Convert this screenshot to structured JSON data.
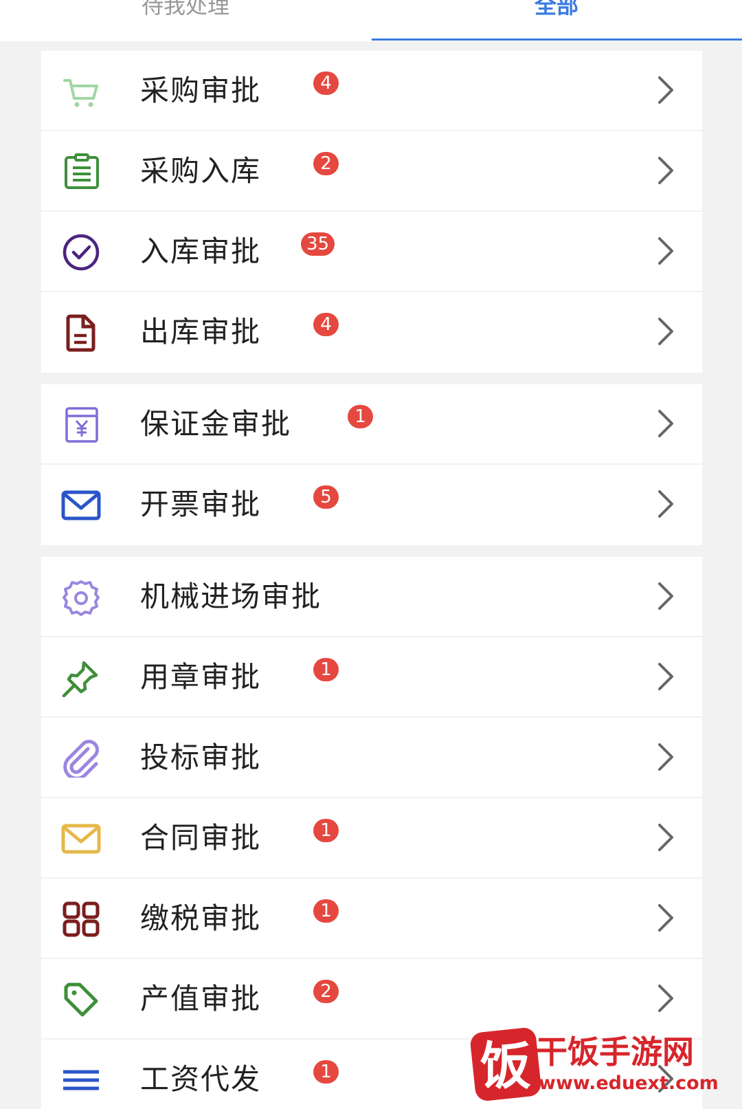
{
  "tabs": [
    {
      "label": "待我处理",
      "active": false
    },
    {
      "label": "全部",
      "active": true
    }
  ],
  "colors": {
    "accent": "#3a7be0",
    "badge": "#e5483f",
    "background": "#f2f2f2"
  },
  "groups": [
    {
      "items": [
        {
          "label": "采购审批",
          "badge": "4",
          "icon": "cart-icon",
          "color": "#9fd6a2"
        },
        {
          "label": "采购入库",
          "badge": "2",
          "icon": "clipboard-icon",
          "color": "#3f8f3a"
        },
        {
          "label": "入库审批",
          "badge": "35",
          "icon": "check-circle-icon",
          "color": "#4a2580"
        },
        {
          "label": "出库审批",
          "badge": "4",
          "icon": "document-icon",
          "color": "#7a1f1f"
        }
      ]
    },
    {
      "items": [
        {
          "label": "保证金审批",
          "badge": "1",
          "icon": "yen-box-icon",
          "color": "#7b6fd8"
        },
        {
          "label": "开票审批",
          "badge": "5",
          "icon": "mail-icon",
          "color": "#2a55c8"
        }
      ]
    },
    {
      "items": [
        {
          "label": "机械进场审批",
          "badge": "",
          "icon": "gear-icon",
          "color": "#9a86e0"
        },
        {
          "label": "用章审批",
          "badge": "1",
          "icon": "pin-icon",
          "color": "#3f8f3a"
        },
        {
          "label": "投标审批",
          "badge": "",
          "icon": "paperclip-icon",
          "color": "#9a86e0"
        },
        {
          "label": "合同审批",
          "badge": "1",
          "icon": "mail-icon",
          "color": "#e6b84a"
        },
        {
          "label": "缴税审批",
          "badge": "1",
          "icon": "grid-icon",
          "color": "#7a1f1f"
        },
        {
          "label": "产值审批",
          "badge": "2",
          "icon": "tag-icon",
          "color": "#3f8f3a"
        },
        {
          "label": "工资代发",
          "badge": "1",
          "icon": "menu-lines-icon",
          "color": "#2a55c8"
        }
      ]
    }
  ],
  "watermark": {
    "logo_glyph": "饭",
    "name": "干饭手游网",
    "url": "www.eduext.com"
  }
}
